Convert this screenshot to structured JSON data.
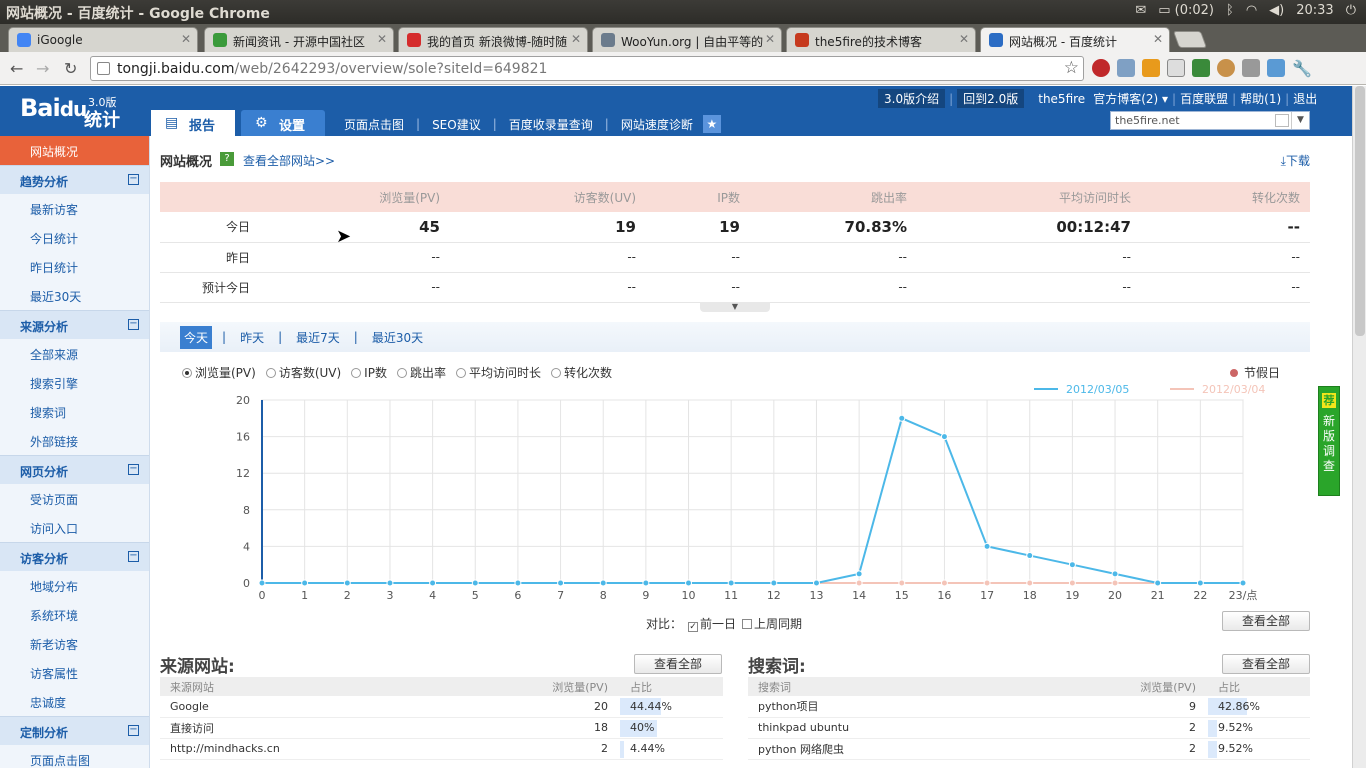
{
  "window": {
    "title": "网站概况 - 百度统计 - Google Chrome"
  },
  "tray": {
    "battery": "(0:02)",
    "clock": "20:33"
  },
  "tabs": [
    {
      "label": "iGoogle",
      "color": "#4285f4"
    },
    {
      "label": "新闻资讯 - 开源中国社区",
      "color": "#3a9a3a"
    },
    {
      "label": "我的首页 新浪微博-随时随",
      "color": "#d52c2c"
    },
    {
      "label": "WooYun.org | 自由平等的",
      "color": "#6b7b8c"
    },
    {
      "label": "the5fire的技术博客",
      "color": "#c63a1e"
    },
    {
      "label": "网站概况 - 百度统计",
      "color": "#2b6cc4"
    }
  ],
  "address": {
    "host": "tongji.baidu.com",
    "path": "/web/2642293/overview/sole?siteId=649821"
  },
  "header": {
    "logo": "Bai",
    "logo_paw": "du",
    "version": "3.0版",
    "logo_sub": "统计",
    "tab_report": "报告",
    "tab_settings": "设置",
    "links": [
      "页面点击图",
      "SEO建议",
      "百度收录量查询",
      "网站速度诊断"
    ],
    "top_links": {
      "intro": "3.0版介绍",
      "back": "回到2.0版",
      "user": "the5fire",
      "blog": "官方博客(2)",
      "union": "百度联盟",
      "help": "帮助(1)",
      "logout": "退出"
    },
    "site_select": "the5fire.net"
  },
  "sidebar": {
    "active": "网站概况",
    "groups": [
      {
        "label": "趋势分析",
        "items": [
          "最新访客",
          "今日统计",
          "昨日统计",
          "最近30天"
        ]
      },
      {
        "label": "来源分析",
        "items": [
          "全部来源",
          "搜索引擎",
          "搜索词",
          "外部链接"
        ]
      },
      {
        "label": "网页分析",
        "items": [
          "受访页面",
          "访问入口"
        ]
      },
      {
        "label": "访客分析",
        "items": [
          "地域分布",
          "系统环境",
          "新老访客",
          "访客属性",
          "忠诚度"
        ]
      },
      {
        "label": "定制分析",
        "items": [
          "页面点击图"
        ]
      }
    ]
  },
  "main": {
    "title": "网站概况",
    "help": "?",
    "view_all": "查看全部网站>>",
    "download": "下载",
    "summary": {
      "headers": [
        "浏览量(PV)",
        "访客数(UV)",
        "IP数",
        "跳出率",
        "平均访问时长",
        "转化次数"
      ],
      "rows": [
        {
          "label": "今日",
          "values": [
            "45",
            "19",
            "19",
            "70.83%",
            "00:12:47",
            "--"
          ]
        },
        {
          "label": "昨日",
          "values": [
            "--",
            "--",
            "--",
            "--",
            "--",
            "--"
          ]
        },
        {
          "label": "预计今日",
          "values": [
            "--",
            "--",
            "--",
            "--",
            "--",
            "--"
          ]
        }
      ]
    },
    "ranges": [
      "今天",
      "昨天",
      "最近7天",
      "最近30天"
    ],
    "metrics": [
      "浏览量(PV)",
      "访客数(UV)",
      "IP数",
      "跳出率",
      "平均访问时长",
      "转化次数"
    ],
    "holiday": "节假日",
    "compare": {
      "label": "对比：",
      "prev_day": "前一日",
      "last_week": "上周同期"
    },
    "view_all_btn": "查看全部"
  },
  "chart_data": {
    "type": "line",
    "x": [
      0,
      1,
      2,
      3,
      4,
      5,
      6,
      7,
      8,
      9,
      10,
      11,
      12,
      13,
      14,
      15,
      16,
      17,
      18,
      19,
      20,
      21,
      22,
      23
    ],
    "x_tick_labels": [
      "0",
      "1",
      "2",
      "3",
      "4",
      "5",
      "6",
      "7",
      "8",
      "9",
      "10",
      "11",
      "12",
      "13",
      "14",
      "15",
      "16",
      "17",
      "18",
      "19",
      "20",
      "21",
      "22",
      "23/点"
    ],
    "ylim": [
      0,
      20
    ],
    "yticks": [
      0,
      4,
      8,
      12,
      16,
      20
    ],
    "grid": true,
    "legend_position": "top-right",
    "series": [
      {
        "name": "2012/03/05",
        "color": "#4cb8e8",
        "values": [
          0,
          0,
          0,
          0,
          0,
          0,
          0,
          0,
          0,
          0,
          0,
          0,
          0,
          0,
          1,
          18,
          16,
          4,
          3,
          2,
          1,
          0,
          0,
          0
        ]
      },
      {
        "name": "2012/03/04",
        "color": "#f4c4b8",
        "values": [
          0,
          0,
          0,
          0,
          0,
          0,
          0,
          0,
          0,
          0,
          0,
          0,
          0,
          0,
          0,
          0,
          0,
          0,
          0,
          0,
          0,
          0,
          0,
          0
        ]
      }
    ]
  },
  "sources": {
    "title": "来源网站:",
    "headers": [
      "来源网站",
      "浏览量(PV)",
      "占比"
    ],
    "rows": [
      {
        "name": "Google",
        "pv": "20",
        "pct": "44.44%",
        "ratio": 0.4444
      },
      {
        "name": "直接访问",
        "pv": "18",
        "pct": "40%",
        "ratio": 0.4
      },
      {
        "name": "http://mindhacks.cn",
        "pv": "2",
        "pct": "4.44%",
        "ratio": 0.0444
      }
    ]
  },
  "keywords": {
    "title": "搜索词:",
    "headers": [
      "搜索词",
      "浏览量(PV)",
      "占比"
    ],
    "rows": [
      {
        "name": "python项目",
        "pv": "9",
        "pct": "42.86%",
        "ratio": 0.4286
      },
      {
        "name": "thinkpad ubuntu",
        "pv": "2",
        "pct": "9.52%",
        "ratio": 0.0952
      },
      {
        "name": "python 网络爬虫",
        "pv": "2",
        "pct": "9.52%",
        "ratio": 0.0952
      }
    ]
  },
  "survey": {
    "label": "新版调查",
    "badge": "荐"
  }
}
